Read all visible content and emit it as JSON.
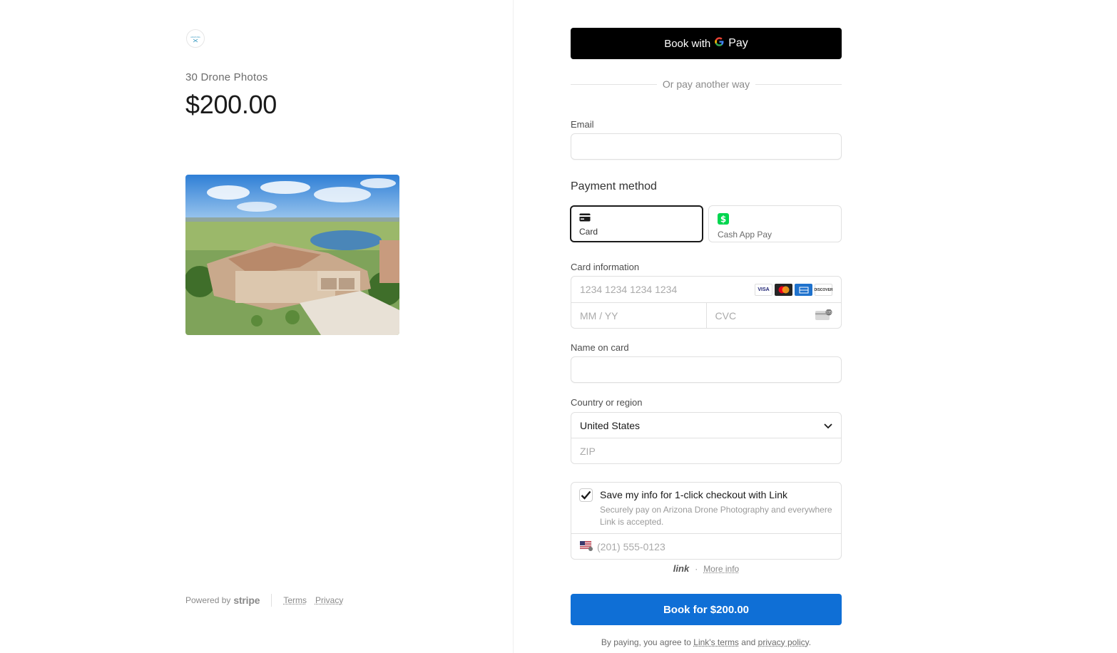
{
  "product": {
    "name": "30 Drone Photos",
    "price": "$200.00",
    "image_alt": "Aerial view of house near golf course and lake"
  },
  "footer": {
    "powered_by": "Powered by",
    "brand": "stripe",
    "terms": "Terms",
    "privacy": "Privacy"
  },
  "gpay": {
    "prefix": "Book with",
    "g": "G",
    "pay": "Pay"
  },
  "divider_text": "Or pay another way",
  "email": {
    "label": "Email",
    "placeholder": ""
  },
  "payment_method": {
    "title": "Payment method",
    "tabs": [
      {
        "label": "Card",
        "icon": "card-icon",
        "active": true
      },
      {
        "label": "Cash App Pay",
        "icon": "cash-app-icon",
        "active": false
      }
    ]
  },
  "card": {
    "label": "Card information",
    "number_placeholder": "1234 1234 1234 1234",
    "expiry_placeholder": "MM / YY",
    "cvc_placeholder": "CVC",
    "brands": [
      "VISA",
      "MC",
      "AMEX",
      "DISCOVER"
    ]
  },
  "name_on_card": {
    "label": "Name on card"
  },
  "country": {
    "label": "Country or region",
    "selected": "United States",
    "zip_placeholder": "ZIP"
  },
  "link": {
    "checked": true,
    "title": "Save my info for 1-click checkout with Link",
    "desc": "Securely pay on Arizona Drone Photography and everywhere Link is accepted.",
    "phone_placeholder": "(201) 555-0123",
    "logo_text": "link",
    "more_info": "More info"
  },
  "book_button": "Book for $200.00",
  "legal": {
    "prefix": "By paying, you agree to",
    "link_terms": "Link's terms",
    "and": "and",
    "privacy_policy": "privacy policy",
    "suffix": "."
  },
  "colors": {
    "primary_button": "#0f6fd6",
    "gpay_button": "#000000",
    "cash_app_green": "#00d64f"
  }
}
